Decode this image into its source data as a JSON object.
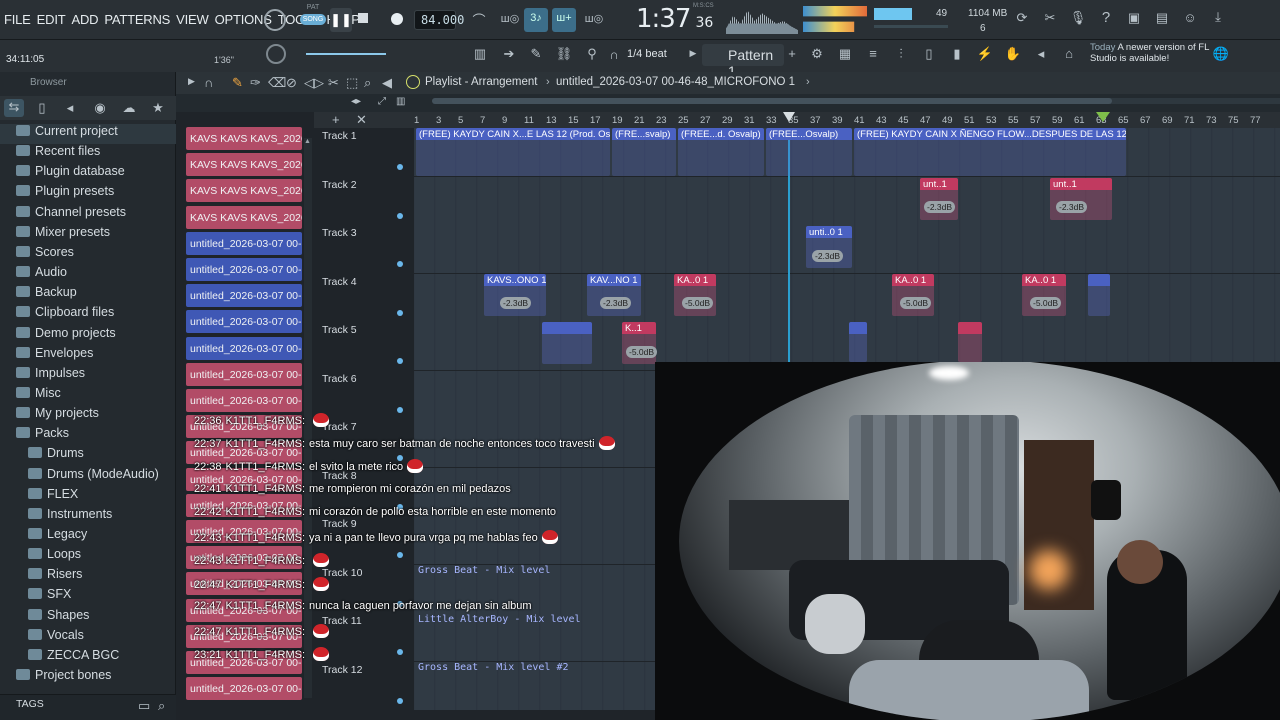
{
  "menu": [
    "FILE",
    "EDIT",
    "ADD",
    "PATTERNS",
    "VIEW",
    "OPTIONS",
    "TOOLS",
    "HELP"
  ],
  "transport": {
    "mode_pat": "PAT",
    "mode_song": "SONG",
    "tempo": "84.000",
    "time": "1:37",
    "time_sub": "36",
    "time_unit": "M:S:CS",
    "cpu_num": "49",
    "mem": "1104 MB",
    "poly": "6",
    "hint_time": "34:11:05",
    "hint_pos": "1'36\""
  },
  "row2": {
    "snap": "1/4 beat",
    "pattern": "Pattern 1",
    "news_today": "Today",
    "news_text": "A newer version of FL Studio is available!"
  },
  "browser": {
    "label": "Browser",
    "tags": "TAGS"
  },
  "tree": [
    "Current project",
    "Recent files",
    "Plugin database",
    "Plugin presets",
    "Channel presets",
    "Mixer presets",
    "Scores",
    "Audio",
    "Backup",
    "Clipboard files",
    "Demo projects",
    "Envelopes",
    "Impulses",
    "Misc",
    "My projects",
    "Packs",
    "Drums",
    "Drums (ModeAudio)",
    "FLEX",
    "Instruments",
    "Legacy",
    "Loops",
    "Risers",
    "SFX",
    "Shapes",
    "Vocals",
    "ZECCA BGC",
    "Project bones"
  ],
  "playlist": {
    "title": "Playlist - Arrangement",
    "path": "untitled_2026-03-07 00-46-48_MICROFONO 1"
  },
  "channels": [
    {
      "label": "KAVS KAVS KAVS_2026-03...",
      "color": "red"
    },
    {
      "label": "KAVS KAVS KAVS_2026-03...",
      "color": "red"
    },
    {
      "label": "KAVS KAVS KAVS_2026-03...",
      "color": "red"
    },
    {
      "label": "KAVS KAVS KAVS_2026-03...",
      "color": "red"
    },
    {
      "label": "untitled_2026-03-07 00-...",
      "color": "blue"
    },
    {
      "label": "untitled_2026-03-07 00-...",
      "color": "blue"
    },
    {
      "label": "untitled_2026-03-07 00-...",
      "color": "blue"
    },
    {
      "label": "untitled_2026-03-07 00-...",
      "color": "blue"
    },
    {
      "label": "untitled_2026-03-07 00-...",
      "color": "blue"
    },
    {
      "label": "untitled_2026-03-07 00-...",
      "color": "red"
    },
    {
      "label": "untitled_2026-03-07 00-...",
      "color": "red"
    },
    {
      "label": "untitled_2026-03-07 00-...",
      "color": "red"
    },
    {
      "label": "untitled_2026-03-07 00-...",
      "color": "red"
    },
    {
      "label": "untitled_2026-03-07 00-...",
      "color": "red"
    },
    {
      "label": "untitled_2026-03-07 00-...",
      "color": "red"
    },
    {
      "label": "untitled_2026-03-07 00-...",
      "color": "red"
    },
    {
      "label": "untitled_2026-03-07 00-...",
      "color": "red"
    },
    {
      "label": "untitled_2026-03-07 00-...",
      "color": "red"
    },
    {
      "label": "untitled_2026-03-07 00-...",
      "color": "red"
    },
    {
      "label": "untitled_2026-03-07 00-...",
      "color": "red"
    },
    {
      "label": "untitled_2026-03-07 00-...",
      "color": "red"
    },
    {
      "label": "untitled_2026-03-07 00-...",
      "color": "red"
    }
  ],
  "ruler": [
    "1",
    "3",
    "5",
    "7",
    "9",
    "11",
    "13",
    "15",
    "17",
    "19",
    "21",
    "23",
    "25",
    "27",
    "29",
    "31",
    "33",
    "35",
    "37",
    "39",
    "41",
    "43",
    "45",
    "47",
    "49",
    "51",
    "53",
    "55",
    "57",
    "59",
    "61",
    "63",
    "65",
    "67",
    "69",
    "71",
    "73",
    "75",
    "77"
  ],
  "tracks": [
    "Track 1",
    "Track 2",
    "Track 3",
    "Track 4",
    "Track 5",
    "Track 6",
    "Track 7",
    "Track 8",
    "Track 9",
    "Track 10",
    "Track 11",
    "Track 12"
  ],
  "clips": {
    "t1a": "(FREE) KAYDY CAIN X...E LAS 12 (Prod. Osvalp)",
    "t1b": "(FRE...svalp)",
    "t1c": "(FREE...d. Osvalp)",
    "t1d": "(FREE...Osvalp)",
    "t1e": "(FREE) KAYDY CAIN X ÑENGO FLOW...DESPUES DE LAS 12 (Prod. Osvalp)",
    "t2a": "unt..1",
    "t2b": "unt..1",
    "t3a": "unti..0 1",
    "t4a": "KAVS..ONO 1",
    "t4b": "KAV...NO 1",
    "t4c": "KA..0 1",
    "t4d": "KA..0 1",
    "t4e": "KA..0 1",
    "t5a": "K..1",
    "g1": "-2.3dB",
    "g2": "-2.3dB",
    "g3": "-2.3dB",
    "g4": "-2.3dB",
    "g5": "-2.3dB",
    "g6": "-5.0dB",
    "g7": "-5.0dB",
    "g8": "-5.0dB",
    "g9": "-5.0dB"
  },
  "automation": {
    "a10": "Gross Beat - Mix level",
    "a11": "Little AlterBoy - Mix level",
    "a12": "Gross Beat - Mix level #2"
  },
  "chat": [
    {
      "time": "22:36",
      "user": "K1TT1_F4RMS:",
      "msg": ""
    },
    {
      "time": "22:37",
      "user": "K1TT1_F4RMS:",
      "msg": "esta muy caro ser batman de noche entonces toco travesti"
    },
    {
      "time": "22:38",
      "user": "K1TT1_F4RMS:",
      "msg": "el svito la mete rico"
    },
    {
      "time": "22:41",
      "user": "K1TT1_F4RMS:",
      "msg": "me rompieron mi corazón en mil pedazos"
    },
    {
      "time": "22:42",
      "user": "K1TT1_F4RMS:",
      "msg": "mi corazón de pollo esta horrible en este momento"
    },
    {
      "time": "22:43",
      "user": "K1TT1_F4RMS:",
      "msg": "ya ni a pan te llevo pura vrga pq me hablas feo"
    },
    {
      "time": "22:43",
      "user": "K1TT1_F4RMS:",
      "msg": ""
    },
    {
      "time": "22:47",
      "user": "K1TT1_F4RMS:",
      "msg": ""
    },
    {
      "time": "22:47",
      "user": "K1TT1_F4RMS:",
      "msg": "nunca la caguen porfavor me dejan sin album"
    },
    {
      "time": "22:47",
      "user": "K1TT1_F4RMS:",
      "msg": ""
    },
    {
      "time": "23:21",
      "user": "K1TT1_F4RMS:",
      "msg": ""
    }
  ]
}
